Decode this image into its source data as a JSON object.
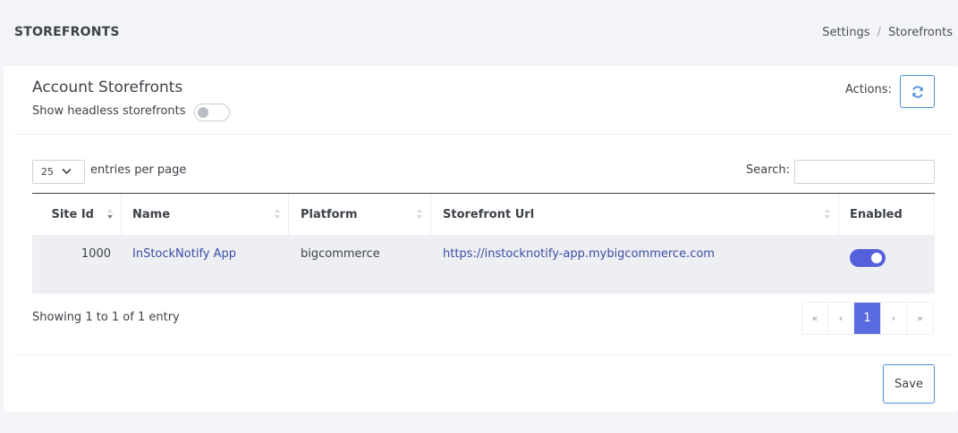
{
  "header": {
    "title": "STOREFRONTS",
    "breadcrumb": [
      "Settings",
      "Storefronts"
    ],
    "separator": "/"
  },
  "card": {
    "title": "Account Storefronts",
    "headless_label": "Show headless storefronts",
    "headless_enabled": false,
    "actions_label": "Actions:",
    "refresh_icon": "refresh-icon"
  },
  "table_controls": {
    "page_length": "25",
    "entries_text": "entries per page",
    "search_label": "Search:",
    "search_value": ""
  },
  "table": {
    "columns": [
      "Site Id",
      "Name",
      "Platform",
      "Storefront Url",
      "Enabled"
    ],
    "rows": [
      {
        "site_id": "1000",
        "name": "InStockNotify App",
        "platform": "bigcommerce",
        "url": "https://instocknotify-app.mybigcommerce.com",
        "enabled": true
      }
    ]
  },
  "footer": {
    "info": "Showing 1 to 1 of 1 entry",
    "pagination": [
      "«",
      "‹",
      "1",
      "›",
      "»"
    ],
    "current_page": "1",
    "save_label": "Save"
  },
  "colors": {
    "accent": "#5a6bdf",
    "button_border": "#4f8fd8",
    "link": "#3b4ea5",
    "row_bg": "#eeeff2"
  }
}
